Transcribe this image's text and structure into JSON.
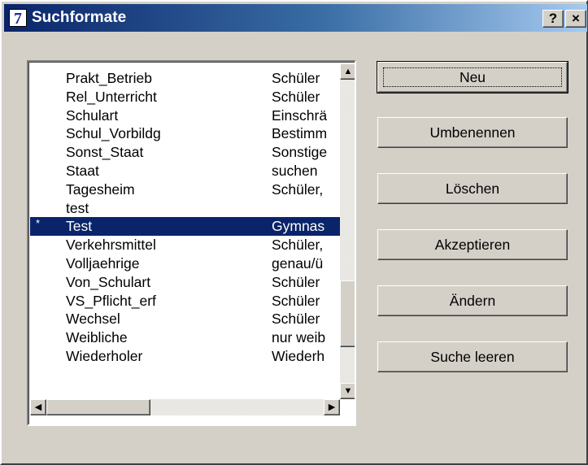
{
  "window": {
    "icon_glyph": "7",
    "title": "Suchformate",
    "help_glyph": "?",
    "close_glyph": "×"
  },
  "list": {
    "items": [
      {
        "marker": "",
        "name": "Prakt_Betrieb",
        "desc": "Schüler"
      },
      {
        "marker": "",
        "name": "Rel_Unterricht",
        "desc": "Schüler"
      },
      {
        "marker": "",
        "name": "Schulart",
        "desc": "Einschrä"
      },
      {
        "marker": "",
        "name": "Schul_Vorbildg",
        "desc": "Bestimm"
      },
      {
        "marker": "",
        "name": "Sonst_Staat",
        "desc": "Sonstige"
      },
      {
        "marker": "",
        "name": "Staat",
        "desc": "suchen"
      },
      {
        "marker": "",
        "name": "Tagesheim",
        "desc": "Schüler,"
      },
      {
        "marker": "",
        "name": "test",
        "desc": ""
      },
      {
        "marker": "*",
        "name": "Test",
        "desc": "Gymnas"
      },
      {
        "marker": "",
        "name": "Verkehrsmittel",
        "desc": "Schüler,"
      },
      {
        "marker": "",
        "name": "Volljaehrige",
        "desc": "genau/ü"
      },
      {
        "marker": "",
        "name": "Von_Schulart",
        "desc": "Schüler"
      },
      {
        "marker": "",
        "name": "VS_Pflicht_erf",
        "desc": "Schüler"
      },
      {
        "marker": "",
        "name": "Wechsel",
        "desc": "Schüler"
      },
      {
        "marker": "",
        "name": "Weibliche",
        "desc": "nur weib"
      },
      {
        "marker": "",
        "name": "Wiederholer",
        "desc": "Wiederh"
      }
    ],
    "selected_index": 8
  },
  "buttons": {
    "neu": "Neu",
    "umbenennen": "Umbenennen",
    "loeschen": "Löschen",
    "akzeptieren": "Akzeptieren",
    "aendern": "Ändern",
    "suche_leeren": "Suche leeren"
  },
  "scroll_glyphs": {
    "up": "▲",
    "down": "▼",
    "left": "◀",
    "right": "▶"
  }
}
